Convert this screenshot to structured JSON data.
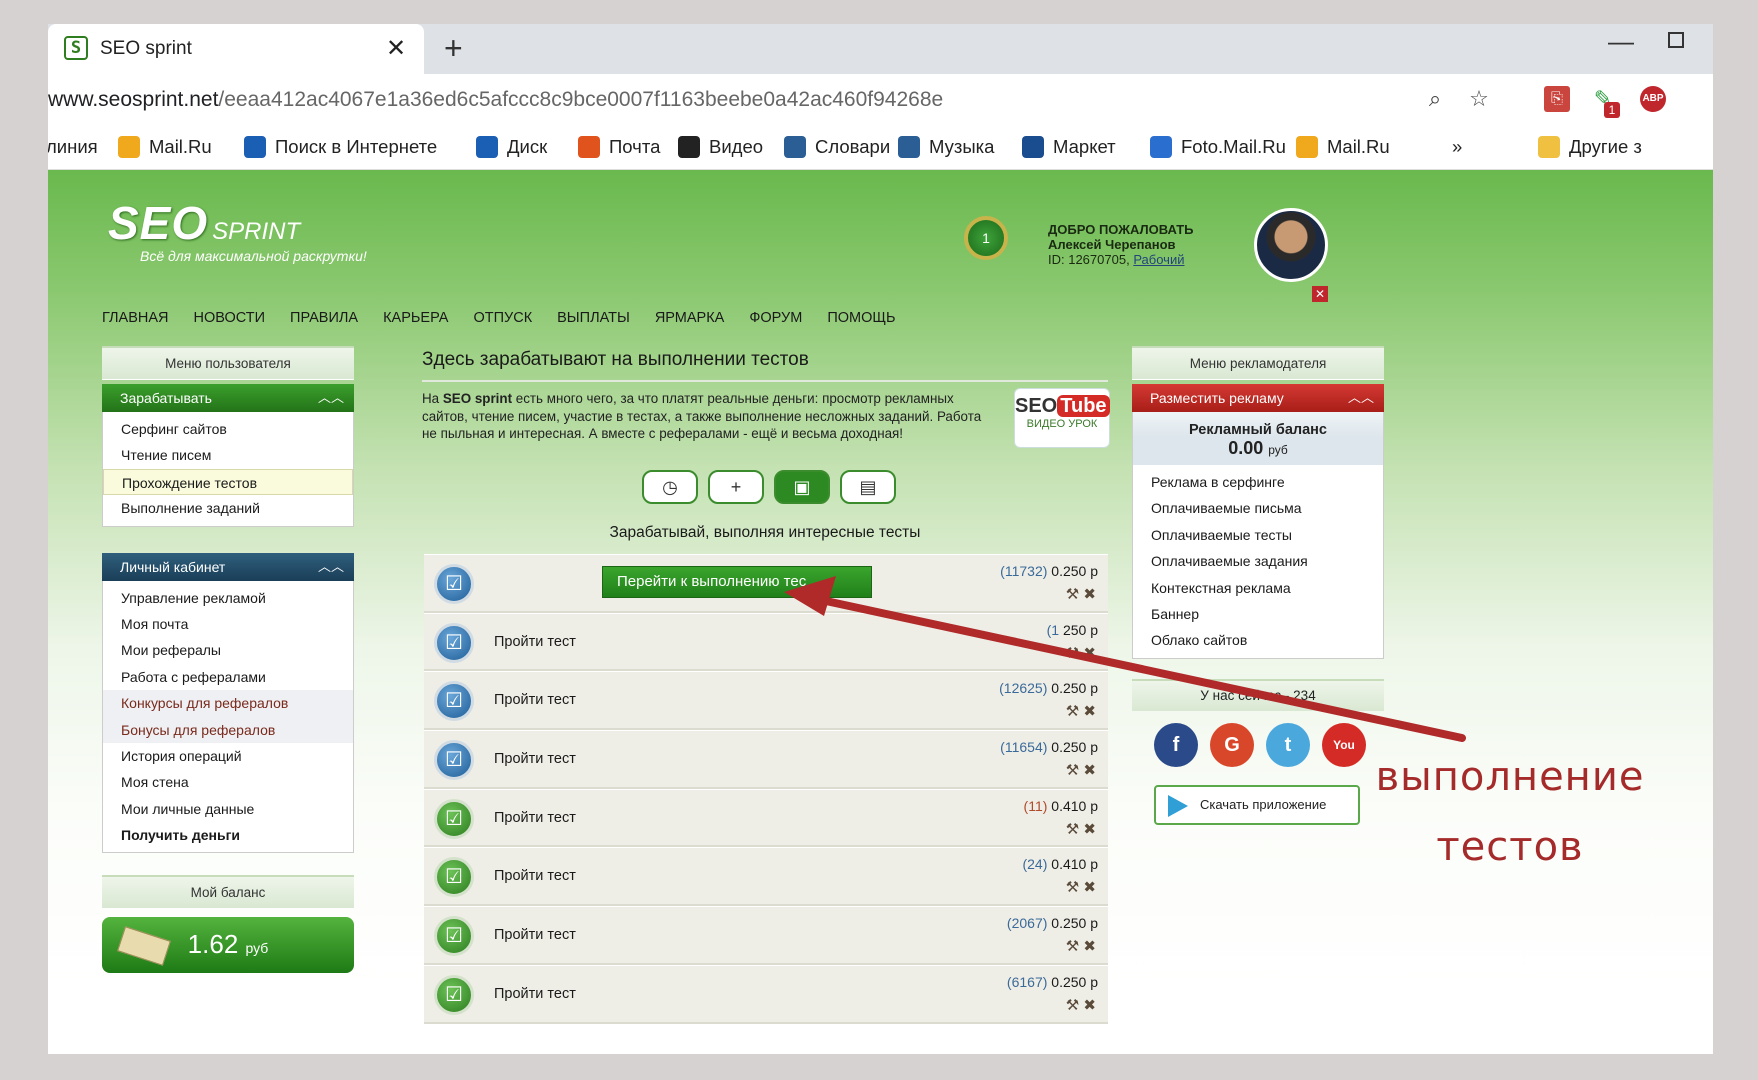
{
  "browser": {
    "tab_title": "SEO sprint",
    "url_domain": "www.seosprint.net",
    "url_path": "/eeaa412ac4067e1a36ed6c5afccc8c9bce0007f1163beebe0a42ac460f94268e",
    "close_glyph": "✕",
    "new_tab_glyph": "+",
    "ext_badge": "1",
    "ext_abp": "ABP",
    "bookmarks": [
      {
        "label": "линия",
        "icon": "none",
        "color": ""
      },
      {
        "label": "Mail.Ru",
        "icon": "mailru-icon",
        "color": "#f0a81c"
      },
      {
        "label": "Поиск в Интернете",
        "icon": "search-icon",
        "color": "#1a5fb4"
      },
      {
        "label": "Диск",
        "icon": "cloud-icon",
        "color": "#1a5fb4"
      },
      {
        "label": "Почта",
        "icon": "mail-icon",
        "color": "#e0531c"
      },
      {
        "label": "Видео",
        "icon": "video-icon",
        "color": "#222"
      },
      {
        "label": "Словари",
        "icon": "dictionary-icon",
        "color": "#2a5e95"
      },
      {
        "label": "Музыка",
        "icon": "music-icon",
        "color": "#2a5e95"
      },
      {
        "label": "Маркет",
        "icon": "cart-icon",
        "color": "#1a4d8f"
      },
      {
        "label": "Foto.Mail.Ru",
        "icon": "photo-icon",
        "color": "#2a6fd0"
      },
      {
        "label": "Mail.Ru",
        "icon": "mailru-icon",
        "color": "#f0a81c"
      },
      {
        "label": "»",
        "icon": "none",
        "color": ""
      },
      {
        "label": "Другие з",
        "icon": "folder-icon",
        "color": "#f0c040"
      }
    ]
  },
  "site": {
    "logo_main": "SEO",
    "logo_sprint": "SPRINT",
    "tagline": "Всё для максимальной раскрутки!",
    "medal_number": "1",
    "welcome": "ДОБРО ПОЖАЛОВАТЬ",
    "user_name": "Алексей Черепанов",
    "user_id_prefix": "ID: 12670705,",
    "user_status": "Рабочий",
    "nav": [
      "ГЛАВНАЯ",
      "НОВОСТИ",
      "ПРАВИЛА",
      "КАРЬЕРА",
      "ОТПУСК",
      "ВЫПЛАТЫ",
      "ЯРМАРКА",
      "ФОРУМ",
      "ПОМОЩЬ"
    ]
  },
  "left": {
    "user_menu_title": "Меню пользователя",
    "earn_title": "Зарабатывать",
    "earn_items": [
      "Серфинг сайтов",
      "Чтение писем",
      "Прохождение тестов",
      "Выполнение заданий"
    ],
    "cabinet_title": "Личный кабинет",
    "cabinet_items": [
      "Управление рекламой",
      "Моя почта",
      "Мои рефералы",
      "Работа с рефералами",
      "Конкурсы для рефералов",
      "Бонусы для рефералов",
      "История операций",
      "Моя стена",
      "Мои личные данные",
      "Получить деньги"
    ],
    "balance_title": "Мой баланс",
    "balance_value": "1.62",
    "balance_unit": "руб"
  },
  "main": {
    "title": "Здесь зарабатывают на выполнении тестов",
    "intro_pre": "На ",
    "intro_bold": "SEO sprint",
    "intro_rest": " есть много чего, за что платят реальные деньги: просмотр рекламных сайтов, чтение писем, участие в тестах, а также выполнение несложных заданий. Работа не пыльная и интересная. А вместе с рефералами - ещё и весьма доходная!",
    "seotube_seo": "SEO",
    "seotube_tube": "Tube",
    "seotube_caption": "ВИДЕО УРОК",
    "subtitle": "Зарабатывай, выполняя интересные тесты",
    "go_button": "Перейти к выполнению тес",
    "row_label": "Пройти тест",
    "rows": [
      {
        "count": "(11732)",
        "price": "0.250 р",
        "color": "blue",
        "expanded": true
      },
      {
        "count": "(1",
        "price": "250 р",
        "color": "blue",
        "expanded": false
      },
      {
        "count": "(12625)",
        "price": "0.250 р",
        "color": "blue",
        "expanded": false
      },
      {
        "count": "(11654)",
        "price": "0.250 р",
        "color": "blue",
        "expanded": false
      },
      {
        "count": "(11)",
        "price": "0.410 р",
        "color": "green",
        "expanded": false
      },
      {
        "count": "(24)",
        "price": "0.410 р",
        "color": "green",
        "expanded": false
      },
      {
        "count": "(2067)",
        "price": "0.250 р",
        "color": "green",
        "expanded": false
      },
      {
        "count": "(6167)",
        "price": "0.250 р",
        "color": "green",
        "expanded": false
      }
    ]
  },
  "right": {
    "adv_menu_title": "Меню рекламодателя",
    "place_ad": "Разместить рекламу",
    "ad_balance_title": "Рекламный баланс",
    "ad_balance_value": "0.00",
    "ad_balance_unit": "руб",
    "ad_items": [
      "Реклама в серфинге",
      "Оплачиваемые письма",
      "Оплачиваемые тесты",
      "Оплачиваемые задания",
      "Контекстная реклама",
      "Баннер",
      "Облако сайтов"
    ],
    "online": "У нас сейчас - 234",
    "social": [
      {
        "glyph": "f",
        "icon": "facebook-icon",
        "color": "#2b4a8a"
      },
      {
        "glyph": "G",
        "icon": "google-icon",
        "color": "#d9472b"
      },
      {
        "glyph": "t",
        "icon": "twitter-icon",
        "color": "#4aa8dd"
      },
      {
        "glyph": "You",
        "icon": "youtube-icon",
        "color": "#d42b26"
      }
    ],
    "app_button": "Скачать приложение"
  },
  "annotation": {
    "line1": "выполнение",
    "line2": "тестов",
    "color": "#b02a2a"
  }
}
